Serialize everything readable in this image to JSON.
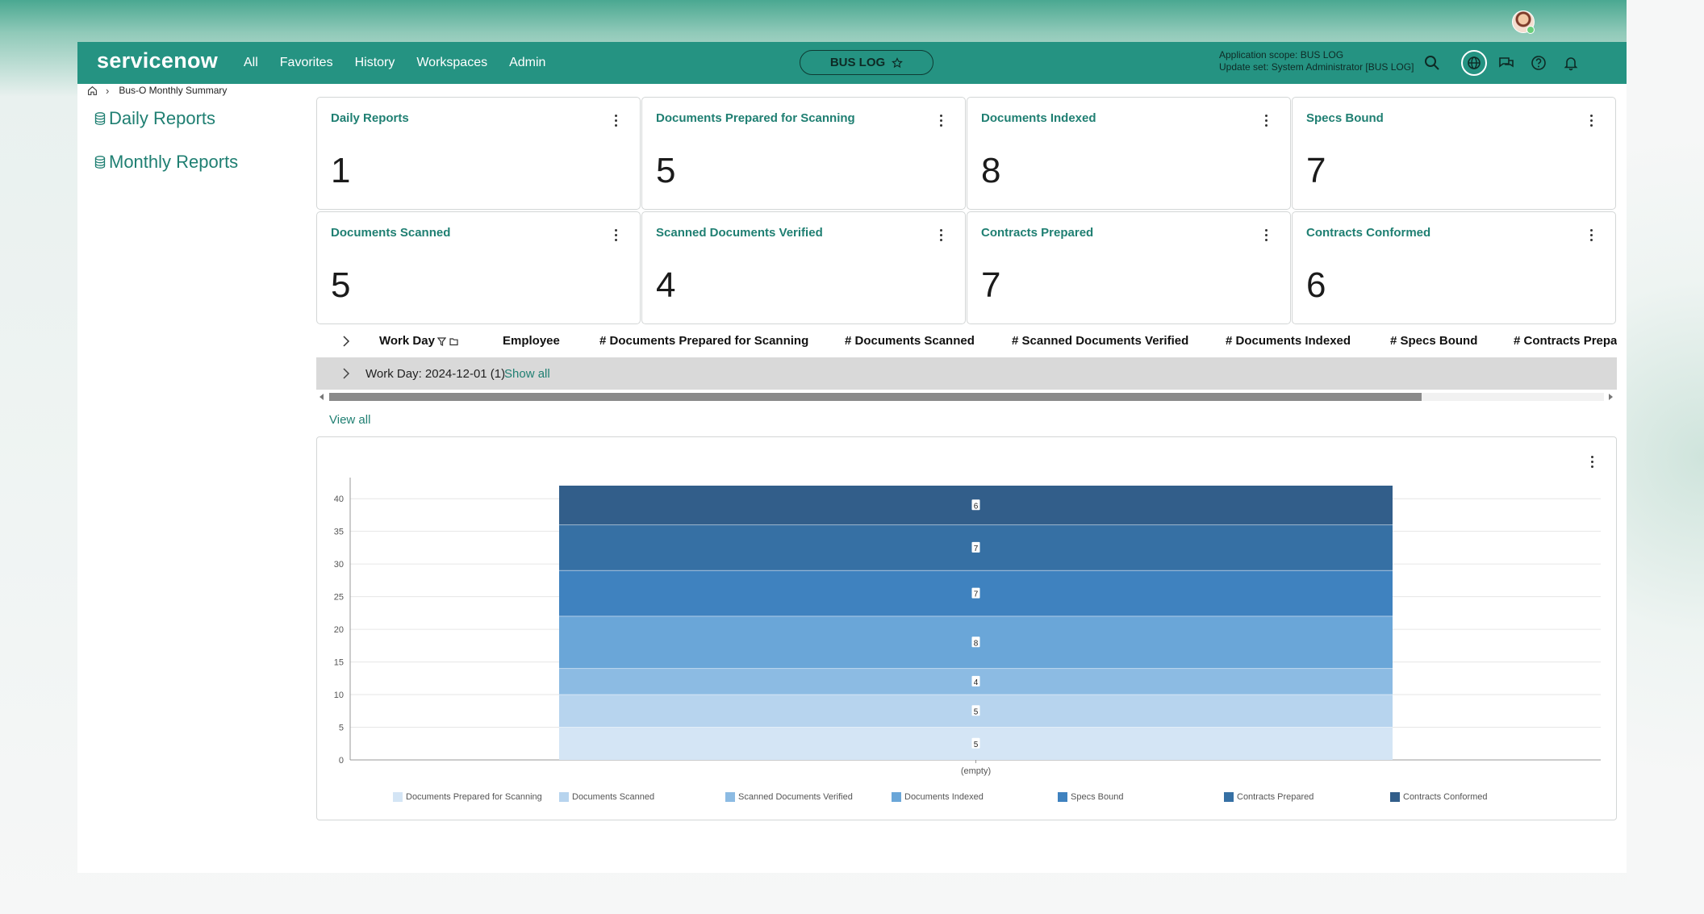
{
  "header": {
    "logo": "servicenow",
    "nav": [
      "All",
      "Favorites",
      "History",
      "Workspaces",
      "Admin"
    ],
    "app_pill": "BUS LOG",
    "scope_line1": "Application scope: BUS LOG",
    "scope_line2": "Update set: System Administrator [BUS LOG]",
    "icons": [
      "search-icon",
      "globe-icon",
      "chat-icon",
      "help-icon",
      "bell-icon",
      "avatar"
    ]
  },
  "breadcrumb": {
    "current": "Bus-O Monthly Summary"
  },
  "sidebar": {
    "items": [
      {
        "label": "Daily Reports"
      },
      {
        "label": "Monthly Reports"
      }
    ]
  },
  "cards": [
    {
      "title": "Daily Reports",
      "value": "1"
    },
    {
      "title": "Documents Prepared for Scanning",
      "value": "5"
    },
    {
      "title": "Documents Indexed",
      "value": "8"
    },
    {
      "title": "Specs Bound",
      "value": "7"
    },
    {
      "title": "Documents Scanned",
      "value": "5"
    },
    {
      "title": "Scanned Documents Verified",
      "value": "4"
    },
    {
      "title": "Contracts Prepared",
      "value": "7"
    },
    {
      "title": "Contracts Conformed",
      "value": "6"
    }
  ],
  "table": {
    "columns": [
      "Work Day",
      "Employee",
      "# Documents Prepared for Scanning",
      "# Documents Scanned",
      "# Scanned Documents Verified",
      "# Documents Indexed",
      "# Specs Bound",
      "# Contracts Prepared"
    ],
    "group_label": "Work Day: 2024-12-01 (1)",
    "show_all": "Show all",
    "view_all": "View all"
  },
  "chart_data": {
    "type": "bar",
    "stacked": true,
    "categories": [
      "(empty)"
    ],
    "series": [
      {
        "name": "Documents Prepared for Scanning",
        "values": [
          5
        ],
        "color": "#d4e5f5"
      },
      {
        "name": "Documents Scanned",
        "values": [
          5
        ],
        "color": "#b7d4ee"
      },
      {
        "name": "Scanned Documents Verified",
        "values": [
          4
        ],
        "color": "#8cbbe3"
      },
      {
        "name": "Documents Indexed",
        "values": [
          8
        ],
        "color": "#6aa6d8"
      },
      {
        "name": "Specs Bound",
        "values": [
          7
        ],
        "color": "#3f82bf"
      },
      {
        "name": "Contracts Prepared",
        "values": [
          7
        ],
        "color": "#3670a4"
      },
      {
        "name": "Contracts Conformed",
        "values": [
          6
        ],
        "color": "#325e8a"
      }
    ],
    "yticks": [
      0,
      5,
      10,
      15,
      20,
      25,
      30,
      35,
      40
    ],
    "ylim": [
      0,
      40
    ],
    "grid": true,
    "legend": "bottom"
  }
}
